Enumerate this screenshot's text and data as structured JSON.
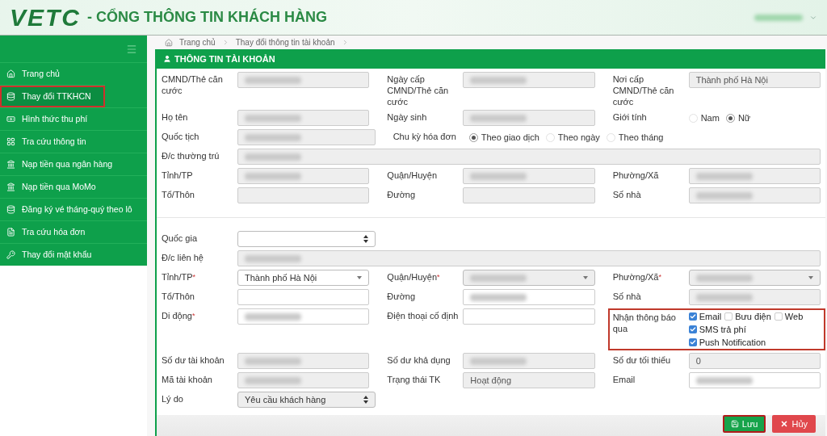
{
  "header": {
    "logo": "VETC",
    "title": "- CỔNG THÔNG TIN KHÁCH HÀNG",
    "user_blurred": true
  },
  "sidebar": {
    "items": [
      {
        "label": "Trang chủ",
        "kind": "home",
        "selected": false,
        "highlighted": false
      },
      {
        "label": "Thay đổi TTKHCN",
        "kind": "database",
        "selected": true,
        "highlighted": true
      },
      {
        "label": "Hình thức thu phí",
        "kind": "money",
        "selected": false,
        "highlighted": false
      },
      {
        "label": "Tra cứu thông tin",
        "kind": "grid",
        "selected": false,
        "highlighted": false
      },
      {
        "label": "Nạp tiền qua ngân hàng",
        "kind": "bank",
        "selected": false,
        "highlighted": false
      },
      {
        "label": "Nạp tiền qua MoMo",
        "kind": "bank",
        "selected": false,
        "highlighted": false
      },
      {
        "label": "Đăng ký vé tháng-quý theo lô",
        "kind": "database",
        "selected": false,
        "highlighted": false
      },
      {
        "label": "Tra cứu hóa đơn",
        "kind": "file",
        "selected": false,
        "highlighted": false
      },
      {
        "label": "Thay đổi mật khẩu",
        "kind": "key",
        "selected": false,
        "highlighted": false
      }
    ]
  },
  "breadcrumb": [
    "Trang chủ",
    "Thay đổi thông tin tài khoản"
  ],
  "panel": {
    "title": "THÔNG TIN TÀI KHOẢN",
    "sections": [
      {
        "rows": [
          [
            {
              "label": "CMND/Thẻ căn cước",
              "kind": "input",
              "readonly": true,
              "blurred": true
            },
            {
              "label": "Ngày cấp CMND/Thẻ căn cước",
              "kind": "input",
              "readonly": true,
              "blurred": true
            },
            {
              "label": "Nơi cấp CMND/Thẻ căn cước",
              "kind": "input",
              "readonly": true,
              "value": "Thành phố Hà Nội"
            }
          ],
          [
            {
              "label": "Họ tên",
              "kind": "input",
              "readonly": true,
              "blurred": true
            },
            {
              "label": "Ngày sinh",
              "kind": "input",
              "readonly": true,
              "blurred": true
            },
            {
              "label": "Giới tính",
              "kind": "radios",
              "options": [
                {
                  "label": "Nam",
                  "selected": false
                },
                {
                  "label": "Nữ",
                  "selected": true
                }
              ]
            }
          ],
          [
            {
              "label": "Quốc tịch",
              "kind": "input",
              "readonly": true,
              "blurred": true
            },
            {
              "label": "Chu kỳ hóa đơn",
              "kind": "radios",
              "wide": true,
              "options": [
                {
                  "label": "Theo giao dịch",
                  "selected": true
                },
                {
                  "label": "Theo ngày",
                  "selected": false
                },
                {
                  "label": "Theo tháng",
                  "selected": false
                }
              ]
            }
          ],
          [
            {
              "label": "Đ/c thường trú",
              "kind": "input",
              "readonly": true,
              "blurred": true,
              "wide": true
            }
          ],
          [
            {
              "label": "Tỉnh/TP",
              "kind": "input",
              "readonly": true,
              "blurred": true
            },
            {
              "label": "Quận/Huyện",
              "kind": "input",
              "readonly": true,
              "blurred": true
            },
            {
              "label": "Phường/Xã",
              "kind": "input",
              "readonly": true,
              "blurred": true
            }
          ],
          [
            {
              "label": "Tổ/Thôn",
              "kind": "input",
              "readonly": true
            },
            {
              "label": "Đường",
              "kind": "input",
              "readonly": true
            },
            {
              "label": "Số nhà",
              "kind": "input",
              "readonly": true,
              "blurred": true
            }
          ]
        ]
      },
      {
        "rows": [
          [
            {
              "label": "Quốc gia",
              "kind": "select",
              "readonly": false
            }
          ],
          [
            {
              "label": "Đ/c liên hệ",
              "kind": "input",
              "readonly": true,
              "blurred": true,
              "wide": true
            }
          ],
          [
            {
              "label": "Tỉnh/TP",
              "required": "*",
              "kind": "dropdown",
              "readonly": false,
              "value": "Thành phố Hà Nội"
            },
            {
              "label": "Quận/Huyện",
              "required": "*",
              "kind": "dropdown",
              "readonly": true,
              "blurred": true
            },
            {
              "label": "Phường/Xã",
              "required": "*",
              "kind": "dropdown",
              "readonly": true,
              "blurred": true
            }
          ],
          [
            {
              "label": "Tổ/Thôn",
              "kind": "input",
              "readonly": false
            },
            {
              "label": "Đường",
              "kind": "input",
              "readonly": false,
              "blurred": true
            },
            {
              "label": "Số nhà",
              "kind": "input",
              "readonly": true,
              "blurred": true
            }
          ],
          [
            {
              "label": "Di động",
              "required": "*",
              "kind": "input",
              "readonly": false,
              "blurred": true
            },
            {
              "label": "Điện thoại cố định",
              "kind": "input",
              "readonly": false
            },
            {
              "label": "Nhận thông báo qua",
              "kind": "checks",
              "highlighted": true,
              "options": [
                {
                  "label": "Email",
                  "checked": true
                },
                {
                  "label": "Bưu điện",
                  "checked": false
                },
                {
                  "label": "Web",
                  "checked": false
                },
                {
                  "label": "SMS trả phí",
                  "checked": true
                },
                {
                  "label": "Push Notification",
                  "checked": true
                }
              ]
            }
          ],
          [
            {
              "label": "Số dư tài khoản",
              "kind": "input",
              "readonly": true,
              "blurred": true
            },
            {
              "label": "Số dư khả dụng",
              "kind": "input",
              "readonly": true,
              "blurred": true
            },
            {
              "label": "Số dư tối thiểu",
              "kind": "input",
              "readonly": true,
              "value": "0"
            }
          ],
          [
            {
              "label": "Mã tài khoản",
              "kind": "input",
              "readonly": true,
              "blurred": true
            },
            {
              "label": "Trạng thái TK",
              "kind": "input",
              "readonly": true,
              "value": "Hoạt động"
            },
            {
              "label": "Email",
              "kind": "input",
              "readonly": false,
              "blurred": true
            }
          ],
          [
            {
              "label": "Lý do",
              "kind": "select",
              "readonly": true,
              "value": "Yêu cầu khách hàng"
            }
          ]
        ]
      }
    ],
    "buttons": [
      {
        "label": "Lưu",
        "kind": "save",
        "highlighted": true
      },
      {
        "label": "Hủy",
        "kind": "cancel",
        "highlighted": false
      }
    ]
  }
}
